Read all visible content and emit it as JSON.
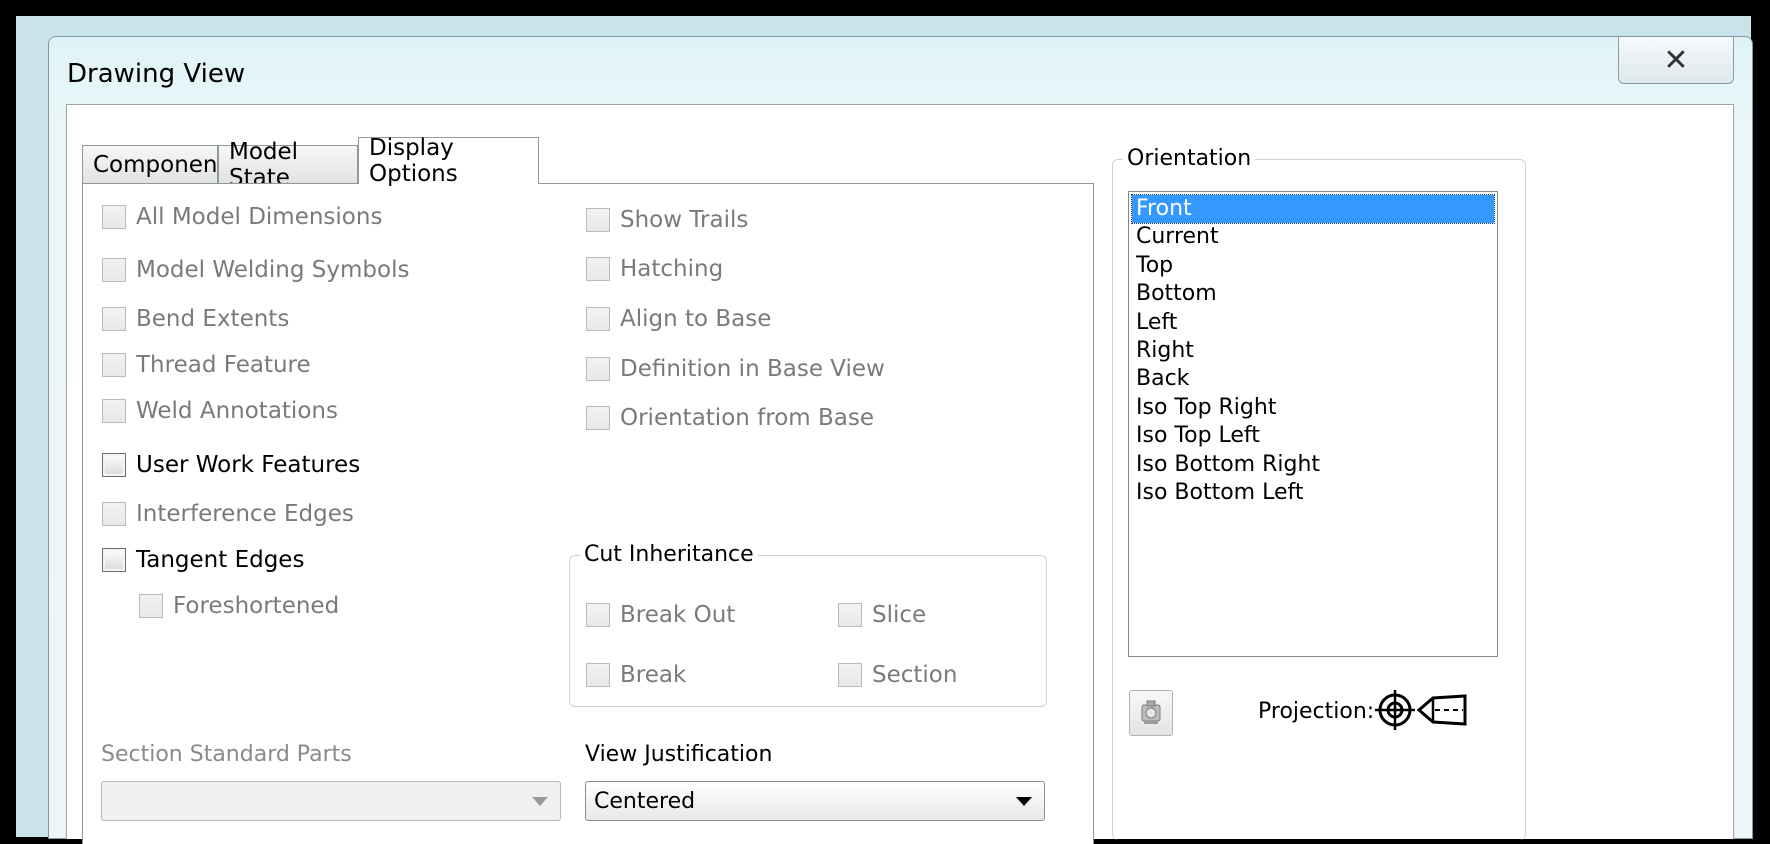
{
  "window": {
    "title": "Drawing View",
    "close_glyph": "✕"
  },
  "tabs": [
    {
      "label": "Component",
      "active": false
    },
    {
      "label": "Model State",
      "active": false
    },
    {
      "label": "Display Options",
      "active": true
    }
  ],
  "display_options": {
    "left_checks": [
      {
        "label": "All Model Dimensions",
        "enabled": false,
        "checked": false
      },
      {
        "label": "Model Welding Symbols",
        "enabled": false,
        "checked": false
      },
      {
        "label": "Bend Extents",
        "enabled": false,
        "checked": false
      },
      {
        "label": "Thread Feature",
        "enabled": false,
        "checked": false
      },
      {
        "label": "Weld Annotations",
        "enabled": false,
        "checked": false
      },
      {
        "label": "User Work Features",
        "enabled": true,
        "checked": false
      },
      {
        "label": "Interference Edges",
        "enabled": false,
        "checked": false
      },
      {
        "label": "Tangent Edges",
        "enabled": true,
        "checked": false
      },
      {
        "label": "Foreshortened",
        "enabled": false,
        "checked": false
      }
    ],
    "right_checks": [
      {
        "label": "Show Trails",
        "enabled": false,
        "checked": false
      },
      {
        "label": "Hatching",
        "enabled": false,
        "checked": false
      },
      {
        "label": "Align to Base",
        "enabled": false,
        "checked": false
      },
      {
        "label": "Definition in Base View",
        "enabled": false,
        "checked": false
      },
      {
        "label": "Orientation from Base",
        "enabled": false,
        "checked": false
      }
    ],
    "cut_inheritance": {
      "legend": "Cut Inheritance",
      "items": [
        {
          "label": "Break Out",
          "enabled": false
        },
        {
          "label": "Slice",
          "enabled": false
        },
        {
          "label": "Break",
          "enabled": false
        },
        {
          "label": "Section",
          "enabled": false
        }
      ]
    },
    "section_standard_parts": {
      "label": "Section Standard Parts",
      "value": ""
    },
    "view_justification": {
      "label": "View Justification",
      "value": "Centered"
    }
  },
  "orientation": {
    "legend": "Orientation",
    "items": [
      "Front",
      "Current",
      "Top",
      "Bottom",
      "Left",
      "Right",
      "Back",
      "Iso Top Right",
      "Iso Top Left",
      "Iso Bottom Right",
      "Iso Bottom Left"
    ],
    "selected": "Front",
    "projection_label": "Projection:",
    "icons": {
      "camera": "camera-icon",
      "projection": "first-angle-projection-icon"
    },
    "selection_color": "#3399ff"
  }
}
